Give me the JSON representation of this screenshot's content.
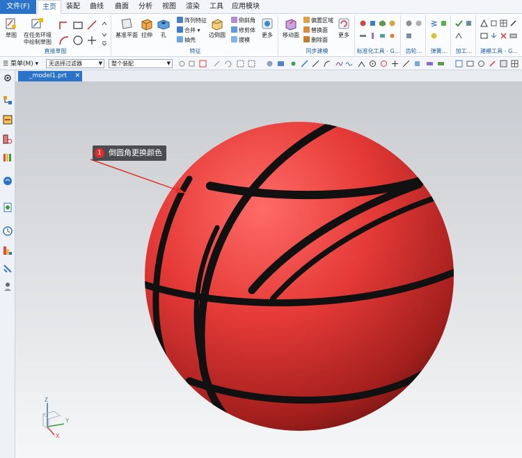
{
  "menu": {
    "file": "文件(F)",
    "tabs": [
      "主页",
      "装配",
      "曲线",
      "曲面",
      "分析",
      "视图",
      "渲染",
      "工具",
      "应用模块"
    ]
  },
  "ribbon": {
    "sketch": {
      "btn1": "草图",
      "btn2": "在任务环境中绘制草图",
      "label": "直接草图"
    },
    "feature": {
      "datum": "基准平面",
      "extrude": "拉伸",
      "hole": "孔",
      "pattern": "阵列特征",
      "unite": "合并",
      "shell": "抽壳",
      "edge_blend": "边倒圆",
      "chamfer": "倒斜角",
      "trim_body": "修剪体",
      "draft": "拔模",
      "more": "更多",
      "label": "特征"
    },
    "sync": {
      "move_face": "移动面",
      "offset_region": "偏置区域",
      "replace_face": "替换面",
      "delete_face": "删除面",
      "more": "更多",
      "label": "同步建模"
    },
    "other_groups": [
      "标准化工具 - G...",
      "齿轮...",
      "弹簧...",
      "加工...",
      "建模工具 - G..."
    ]
  },
  "quickbar": {
    "menu_label": "菜单(M)",
    "filter_value": "无选择过滤器",
    "scope_value": "整个装配"
  },
  "document": {
    "tab_name": "_model1.prt"
  },
  "annotation": {
    "number": "1",
    "text": "倒圆角更换颜色"
  },
  "colors": {
    "accent": "#2b73c9",
    "ball": "#e53a37",
    "seam": "#111111",
    "annotation_bg": "#4a4c50",
    "badge": "#e02b2b"
  },
  "triad": {
    "x": "X",
    "y": "Y",
    "z": "Z"
  }
}
